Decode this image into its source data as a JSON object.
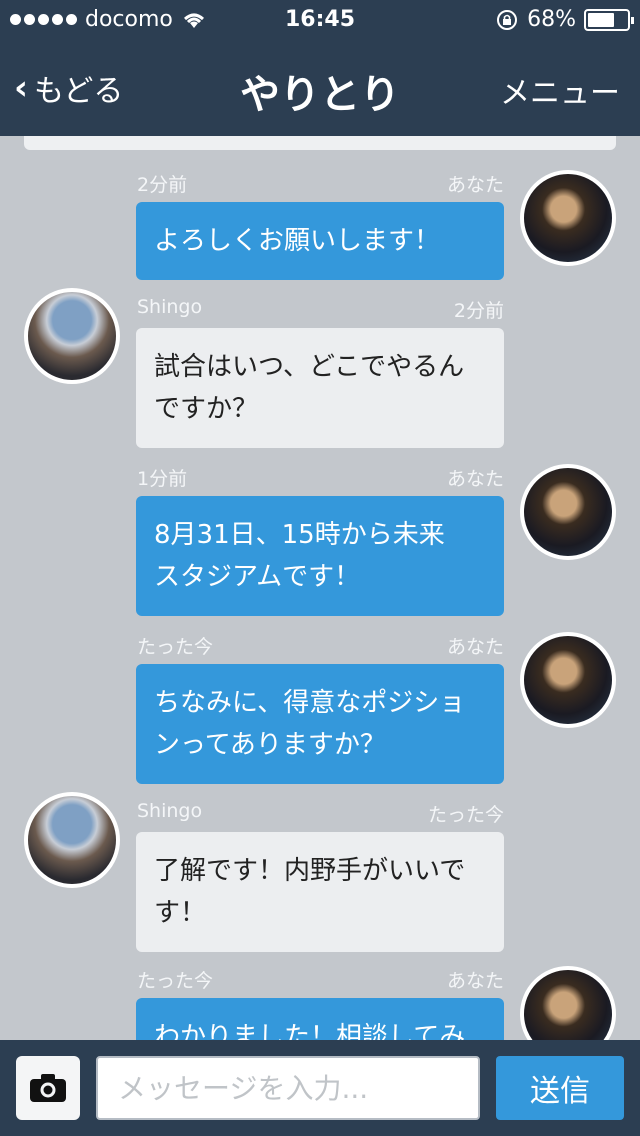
{
  "status_bar": {
    "carrier": "docomo",
    "time": "16:45",
    "battery": "68%",
    "battery_level": 0.68
  },
  "nav": {
    "back_label": "もどる",
    "title": "やりとり",
    "menu_label": "メニュー"
  },
  "messages": [
    {
      "sender": "me",
      "meta_left": "2分前",
      "meta_right": "あなた",
      "lines": [
        "よろしくお願いします！"
      ]
    },
    {
      "sender": "them",
      "meta_left": "Shingo",
      "meta_right": "2分前",
      "lines": [
        "試合はいつ、どこでやるん",
        "ですか？"
      ]
    },
    {
      "sender": "me",
      "meta_left": "1分前",
      "meta_right": "あなた",
      "lines": [
        "8月31日、15時から未来",
        "スタジアムです！"
      ]
    },
    {
      "sender": "me",
      "meta_left": "たった今",
      "meta_right": "あなた",
      "lines": [
        "ちなみに、得意なポジショ",
        "ンってありますか？"
      ]
    },
    {
      "sender": "them",
      "meta_left": "Shingo",
      "meta_right": "たった今",
      "lines": [
        "了解です！内野手がいいで",
        "す！"
      ]
    },
    {
      "sender": "me",
      "meta_left": "たった今",
      "meta_right": "あなた",
      "lines": [
        "わかりました！相談してみ",
        ""
      ]
    }
  ],
  "input": {
    "placeholder": "メッセージを入力...",
    "value": "",
    "send_label": "送信"
  },
  "icons": {
    "camera": "camera-icon",
    "wifi": "wifi-icon",
    "lock": "rotation-lock-icon",
    "back": "chevron-left-icon"
  },
  "colors": {
    "bar": "#2c3e52",
    "accent": "#3498db",
    "chat_bg": "#c3c7cc",
    "bubble_them": "#eceef0"
  }
}
